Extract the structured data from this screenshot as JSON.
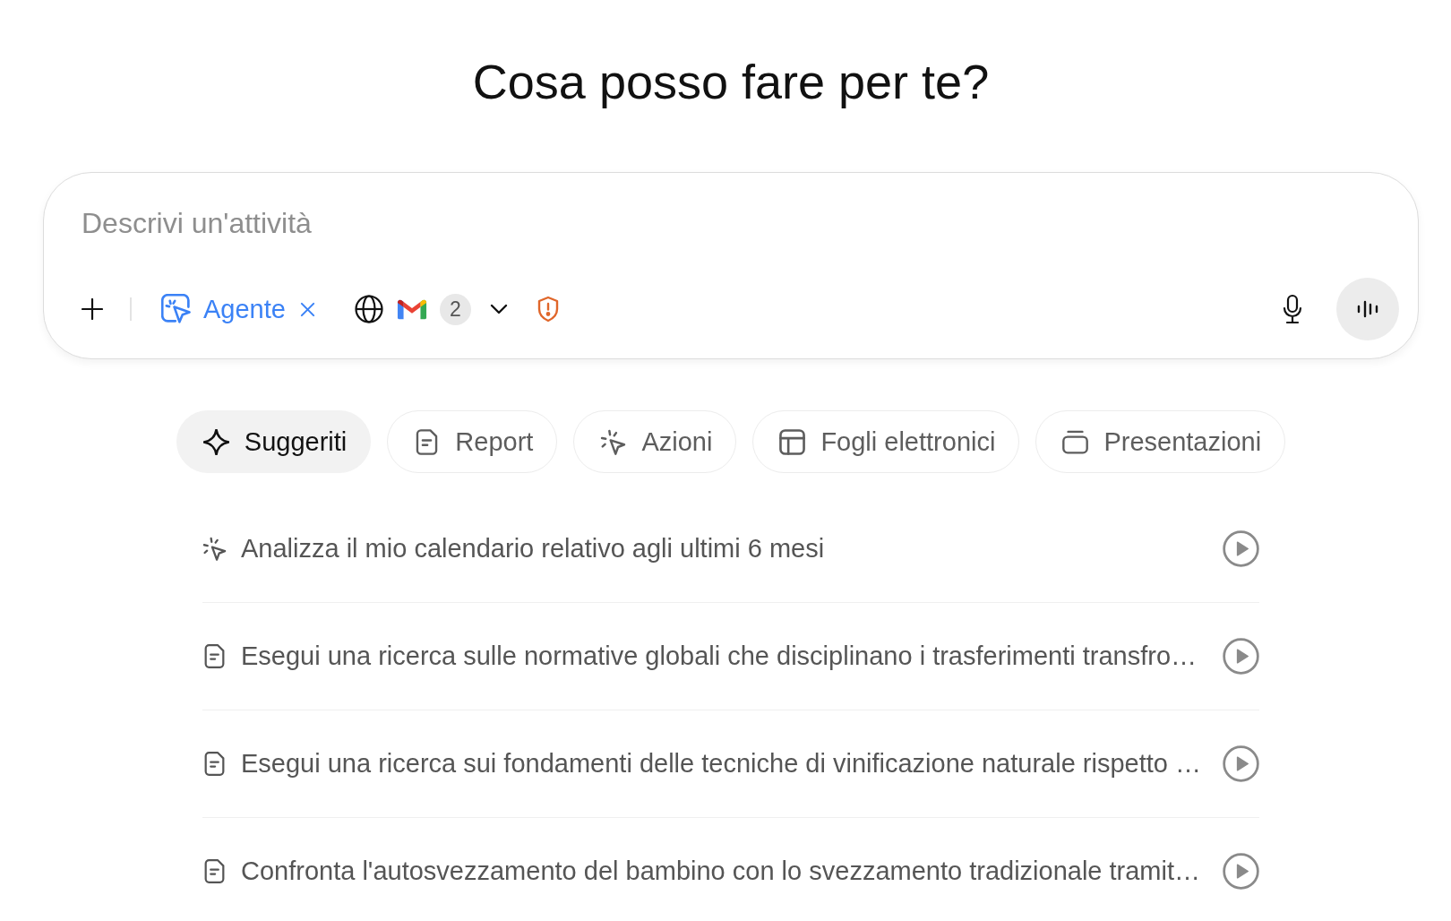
{
  "heading": "Cosa posso fare per te?",
  "composer": {
    "placeholder": "Descrivi un'attività",
    "mode_chip": {
      "label": "Agente"
    },
    "connector_count": "2"
  },
  "tabs": [
    {
      "label": "Suggeriti",
      "kind": "suggested",
      "selected": true
    },
    {
      "label": "Report",
      "kind": "report",
      "selected": false
    },
    {
      "label": "Azioni",
      "kind": "actions",
      "selected": false
    },
    {
      "label": "Fogli elettronici",
      "kind": "spreadsheets",
      "selected": false
    },
    {
      "label": "Presentazioni",
      "kind": "slides",
      "selected": false
    }
  ],
  "suggestions": [
    {
      "kind": "action",
      "text": "Analizza il mio calendario relativo agli ultimi 6 mesi"
    },
    {
      "kind": "report",
      "text": "Esegui una ricerca sulle normative globali che disciplinano i trasferimenti transfro…"
    },
    {
      "kind": "report",
      "text": "Esegui una ricerca sui fondamenti delle tecniche di vinificazione naturale rispetto …"
    },
    {
      "kind": "report",
      "text": "Confronta l'autosvezzamento del bambino con lo svezzamento tradizionale tramit…"
    }
  ]
}
